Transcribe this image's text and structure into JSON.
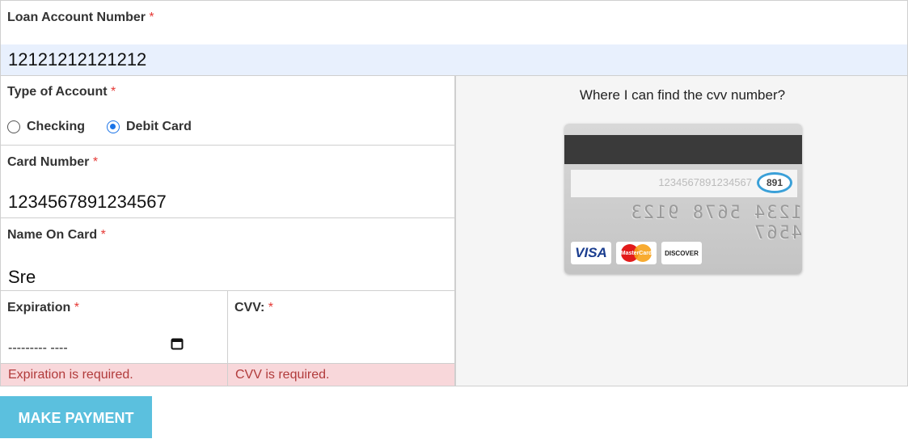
{
  "loan": {
    "label": "Loan Account Number",
    "required": "*",
    "value": "12121212121212"
  },
  "account_type": {
    "label": "Type of Account",
    "required": "*",
    "options": [
      {
        "label": "Checking",
        "selected": false
      },
      {
        "label": "Debit Card",
        "selected": true
      }
    ]
  },
  "card_number": {
    "label": "Card Number",
    "required": "*",
    "value": "1234567891234567"
  },
  "name_on_card": {
    "label": "Name On Card",
    "required": "*",
    "value": "Sre"
  },
  "expiration": {
    "label": "Expiration",
    "required": "*",
    "placeholder": "--------- ----",
    "error": "Expiration is required."
  },
  "cvv": {
    "label": "CVV:",
    "required": "*",
    "error": "CVV is required."
  },
  "help": {
    "title": "Where I can find the cvv number?",
    "card_image": {
      "signature_digits": "1234567891234567",
      "cvv_digits": "891",
      "embossed_number": "1234 5678 9123 4567",
      "logos": [
        "VISA",
        "MasterCard",
        "DISCOVER"
      ]
    }
  },
  "submit": {
    "label": "MAKE PAYMENT"
  },
  "colors": {
    "accent": "#5bc0de",
    "error_bg": "#f8d7da",
    "error_text": "#b13b3b",
    "input_bg": "#e8f0fd",
    "radio": "#1a73e8"
  }
}
